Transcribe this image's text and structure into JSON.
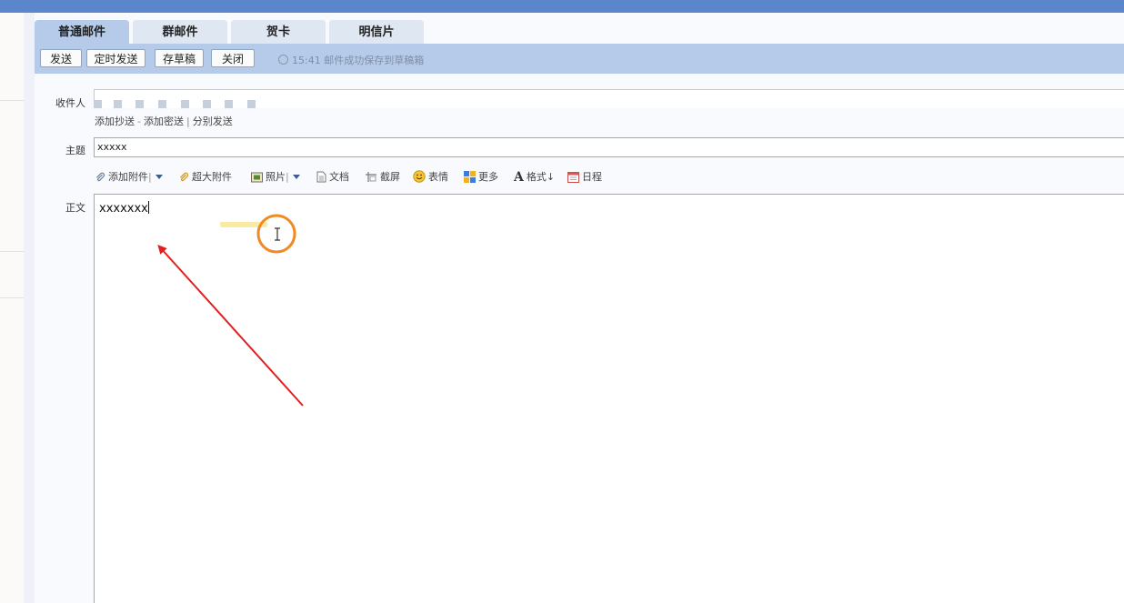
{
  "tabs": [
    {
      "label": "普通邮件"
    },
    {
      "label": "群邮件"
    },
    {
      "label": "贺卡"
    },
    {
      "label": "明信片"
    }
  ],
  "toolbar": {
    "send": "发送",
    "schedule": "定时发送",
    "draft": "存草稿",
    "close": "关闭",
    "status": "15:41 邮件成功保存到草稿箱"
  },
  "recipient": {
    "label": "收件人",
    "add_cc": "添加抄送",
    "dash": "-",
    "add_bcc": "添加密送",
    "pipe": "|",
    "separate": "分别发送"
  },
  "subject": {
    "label": "主题",
    "value": "xxxxx"
  },
  "attach_toolbar": {
    "add_attachment": "添加附件",
    "large_attachment": "超大附件",
    "photo": "照片",
    "document": "文档",
    "screenshot": "截屏",
    "emoji": "表情",
    "more": "更多",
    "format": "格式",
    "schedule": "日程"
  },
  "body": {
    "label": "正文",
    "value": "xxxxxxx"
  },
  "colors": {
    "topbar": "#5b86cc",
    "toolbar": "#b5cbe9",
    "annotation_arrow": "#e02020",
    "cursor_ring": "#f08a24"
  },
  "icons": {
    "attach": "paperclip-icon",
    "large_attach": "paperclip-icon",
    "photo": "photo-icon",
    "document": "document-icon",
    "screenshot": "scissors-icon",
    "emoji": "smiley-icon",
    "more": "grid-icon",
    "format": "letter-a-icon",
    "schedule": "calendar-icon"
  }
}
